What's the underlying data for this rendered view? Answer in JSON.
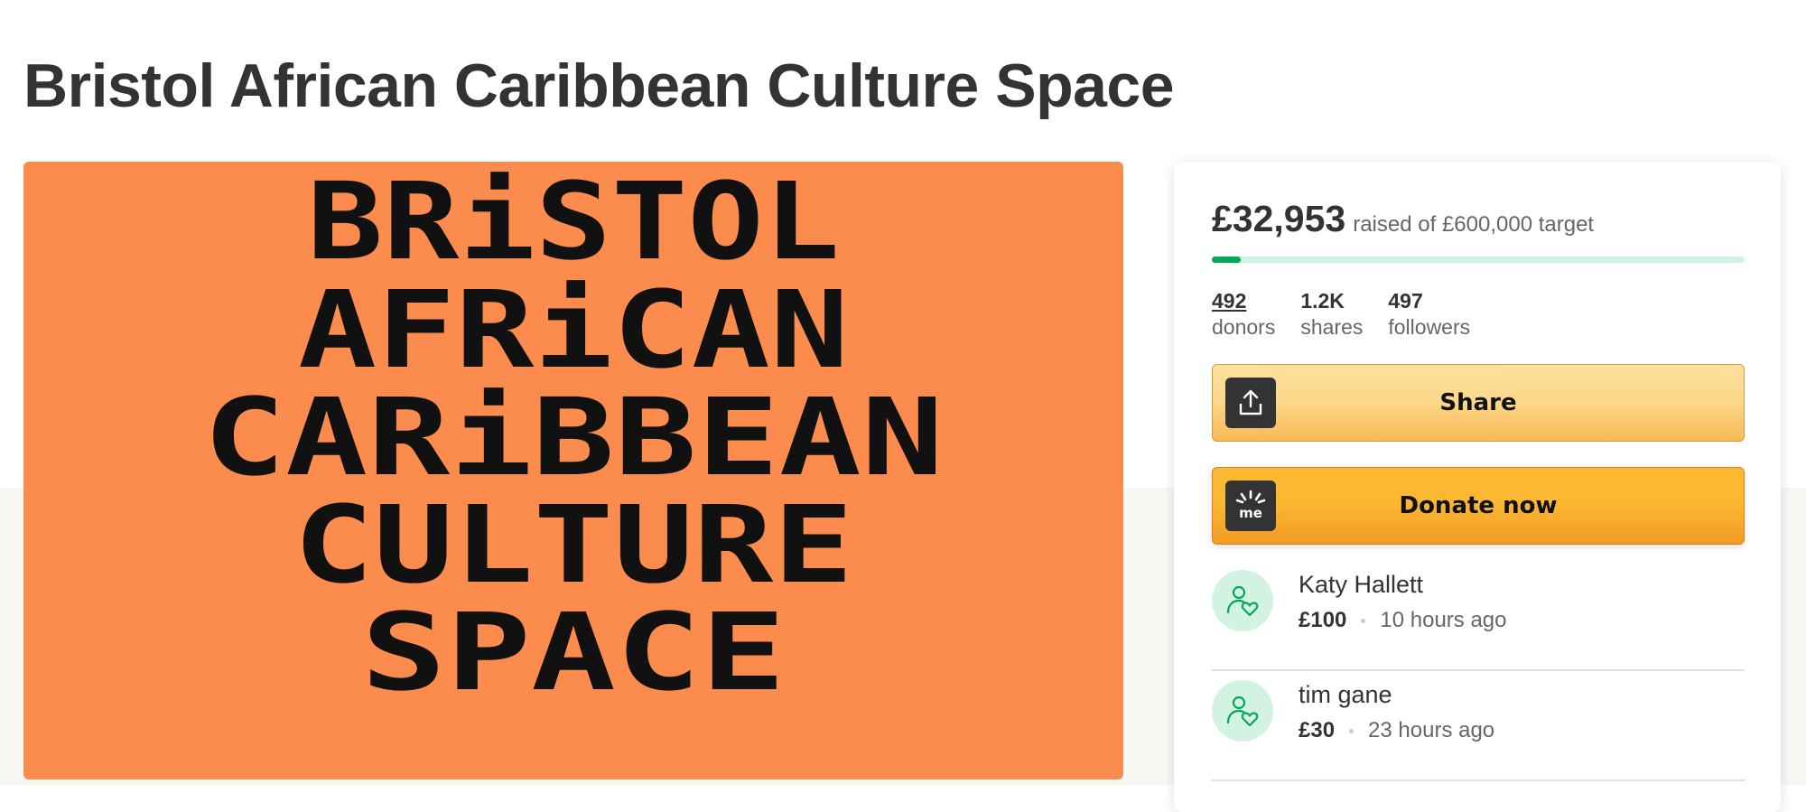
{
  "page": {
    "title": "Bristol African Caribbean Culture Space"
  },
  "hero": {
    "lines": [
      "BRiSTOL",
      "AFRiCAN",
      "CARiBBEAN",
      "CULTURE",
      "SPACE"
    ],
    "background": "#fc8c4d"
  },
  "fundraiser": {
    "amount_raised": "£32,953",
    "target_text": "raised of £600,000 target",
    "progress_fraction": 0.055,
    "stats": [
      {
        "value": "492",
        "label": "donors"
      },
      {
        "value": "1.2K",
        "label": "shares"
      },
      {
        "value": "497",
        "label": "followers"
      }
    ],
    "share_label": "Share",
    "donate_label": "Donate now",
    "donate_icon_text": "me",
    "donations": [
      {
        "name": "Katy Hallett",
        "amount": "£100",
        "time": "10 hours ago"
      },
      {
        "name": "tim gane",
        "amount": "£30",
        "time": "23 hours ago"
      }
    ]
  },
  "icons": {
    "share": "share-upload-icon",
    "donate": "gofundme-icon",
    "donor": "donor-heart-icon"
  },
  "colors": {
    "accent_green": "#02a95c",
    "share_button": "#fcd88c",
    "donate_button": "#fbb833"
  }
}
